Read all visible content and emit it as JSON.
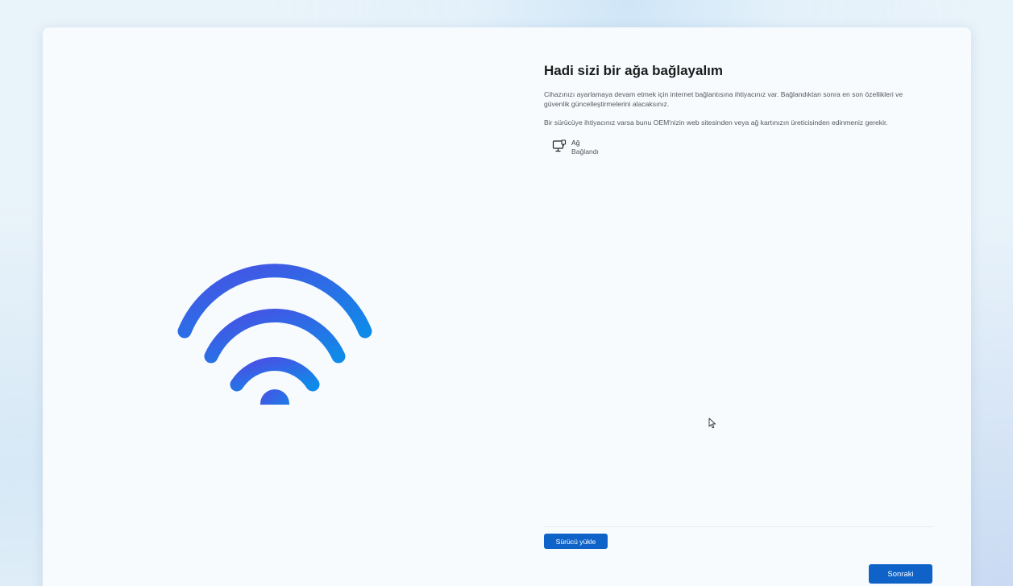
{
  "page": {
    "title": "Hadi sizi bir ağa bağlayalım",
    "description_1": "Cihazınızı ayarlamaya devam etmek için internet bağlantısına ihtiyacınız var. Bağlandıktan sonra en son özellikleri ve güvenlik güncelleştirmelerini alacaksınız.",
    "description_2": "Bir sürücüye ihtiyacınız varsa bunu OEM'nizin web sitesinden veya ağ kartınızın üreticisinden edinmeniz gerekir."
  },
  "network": {
    "icon": "wired-network-icon",
    "name": "Ağ",
    "status": "Bağlandı"
  },
  "buttons": {
    "install_driver": "Sürücü yükle",
    "next": "Sonraki"
  },
  "illustration": {
    "icon": "wifi-icon",
    "gradient_start": "#4a55e6",
    "gradient_end": "#1886e8"
  },
  "colors": {
    "accent": "#0f63c8",
    "card_background": "#f7fbfd"
  }
}
